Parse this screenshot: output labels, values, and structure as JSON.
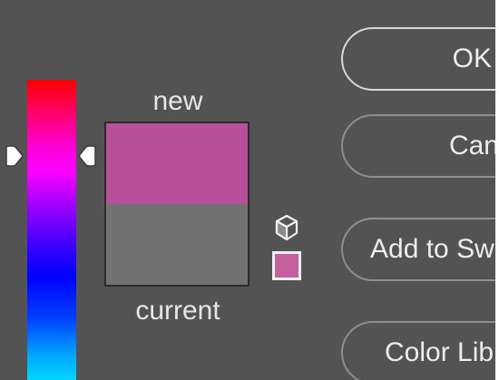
{
  "labels": {
    "new": "new",
    "current": "current"
  },
  "colors": {
    "new_color": "#b74f9b",
    "current_color": "#727272",
    "websafe_color": "#c6609d",
    "background": "#535353"
  },
  "buttons": {
    "ok": "OK",
    "cancel": "Cancel",
    "add_to_swatches": "Add to Swatches",
    "color_libraries": "Color Libraries"
  },
  "buttons_visible": {
    "ok": "OK",
    "cancel": "Canc",
    "add_to_swatches": "Add to Sw",
    "color_libraries": "Color Lib"
  },
  "icons": {
    "gamut_warning": "cube-icon",
    "hue_handle": "triangle-pointer-icon"
  }
}
